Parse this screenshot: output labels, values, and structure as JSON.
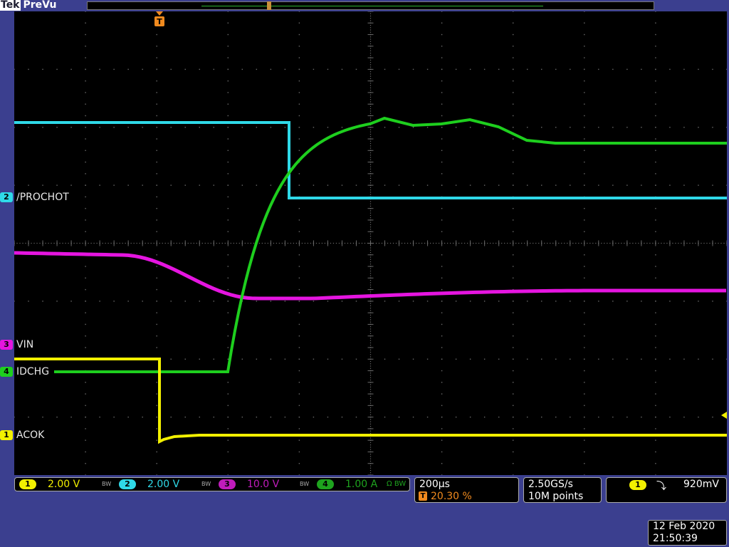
{
  "header": {
    "brand": "Tek",
    "mode": "PreVu"
  },
  "trigger_marker": "T",
  "channels": [
    {
      "num": "2",
      "name": "/PROCHOT",
      "color": "#2fd9e8"
    },
    {
      "num": "3",
      "name": "VIN",
      "color": "#e515e0"
    },
    {
      "num": "4",
      "name": "IDCHG",
      "color": "#1ecf1e"
    },
    {
      "num": "1",
      "name": "ACOK",
      "color": "#f2f000"
    }
  ],
  "status": {
    "ch1": {
      "num": "1",
      "scale": "2.00 V",
      "bw": "BW"
    },
    "ch2": {
      "num": "2",
      "scale": "2.00 V",
      "bw": "BW"
    },
    "ch3": {
      "num": "3",
      "scale": "10.0 V",
      "bw": "BW"
    },
    "ch4": {
      "num": "4",
      "scale": "1.00 A",
      "bw": "Ω BW"
    }
  },
  "timebase": {
    "scale": "200µs",
    "trigger_icon": "T",
    "position": "20.30 %"
  },
  "acquisition": {
    "rate": "2.50GS/s",
    "points": "10M points"
  },
  "trigger": {
    "source": "1",
    "slope_icon": "falling-edge-icon",
    "slope_glyph": "⤵",
    "level": "920mV"
  },
  "datetime": {
    "date": "12 Feb  2020",
    "time": "21:50:39"
  }
}
